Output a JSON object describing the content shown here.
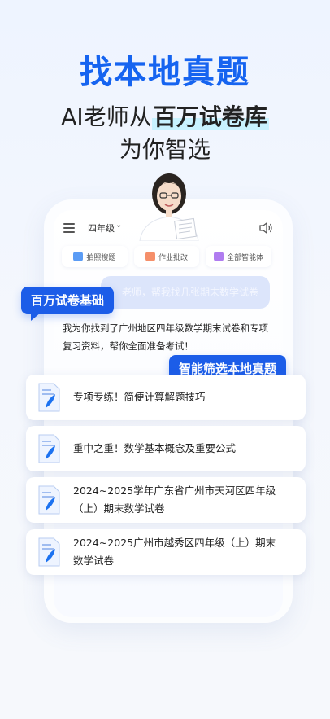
{
  "headline": {
    "title": "找本地真题",
    "line1_prefix": "AI老师从",
    "line1_highlight": "百万试卷库",
    "line2": "为你智选"
  },
  "app": {
    "grade": "四年级",
    "actions": [
      {
        "label": "拍照搜题",
        "icon": "camera-search-icon",
        "color": "#5b9cf5"
      },
      {
        "label": "作业批改",
        "icon": "homework-check-icon",
        "color": "#f58f6a"
      },
      {
        "label": "全部智能体",
        "icon": "agents-icon",
        "color": "#b07cf0"
      }
    ],
    "user_message": "老师，帮我找几张期末数学试卷",
    "reply": "我为你找到了广州地区四年级数学期末试卷和专项复习资料，帮你全面准备考试！"
  },
  "tags": {
    "tag1": "百万试卷基础",
    "tag2": "智能筛选本地真题"
  },
  "results": [
    {
      "title": "专项专练！简便计算解题技巧",
      "icon": "document-icon"
    },
    {
      "title": "重中之重！数学基本概念及重要公式",
      "icon": "document-icon"
    },
    {
      "title": "2024~2025学年广东省广州市天河区四年级（上）期末数学试卷",
      "icon": "document-icon"
    },
    {
      "title": "2024~2025广州市越秀区四年级（上）期末数学试卷",
      "icon": "document-icon"
    }
  ],
  "colors": {
    "brand": "#1664f0",
    "tag_bg": "#1c5de8",
    "highlight": "#c8f2ff"
  }
}
